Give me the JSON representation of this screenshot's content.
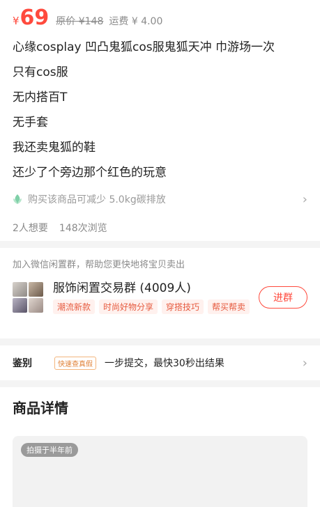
{
  "price": {
    "currency_symbol": "¥",
    "amount": "69",
    "original_label": "原价 ¥148",
    "shipping_label": "运费 ¥ 4.00"
  },
  "description": {
    "lines": [
      "心缘cosplay 凹凸鬼狐cos服鬼狐天冲 巾游场一次",
      "只有cos服",
      "无内搭百T",
      "无手套",
      "我还卖鬼狐的鞋",
      "还少了个旁边那个红色的玩意"
    ]
  },
  "carbon": {
    "text": "购买该商品可减少 5.0kg碳排放",
    "icon": "leaf-icon"
  },
  "stats": {
    "wants": "2人想要",
    "views": "148次浏览"
  },
  "group": {
    "hint": "加入微信闲置群，帮助您更快地将宝贝卖出",
    "name": "服饰闲置交易群 (4009人)",
    "tags": [
      "潮流新款",
      "时尚好物分享",
      "穿搭技巧",
      "帮买帮卖"
    ],
    "join_label": "进群"
  },
  "authentication": {
    "label": "鉴别",
    "badge": "快速查真假",
    "text": "一步提交，最快30秒出结果"
  },
  "details": {
    "title": "商品详情",
    "photo_badge": "拍摄于半年前"
  },
  "colors": {
    "accent": "#ff4a3d",
    "tag_text": "#e65a3f",
    "badge_orange": "#e0833a"
  }
}
